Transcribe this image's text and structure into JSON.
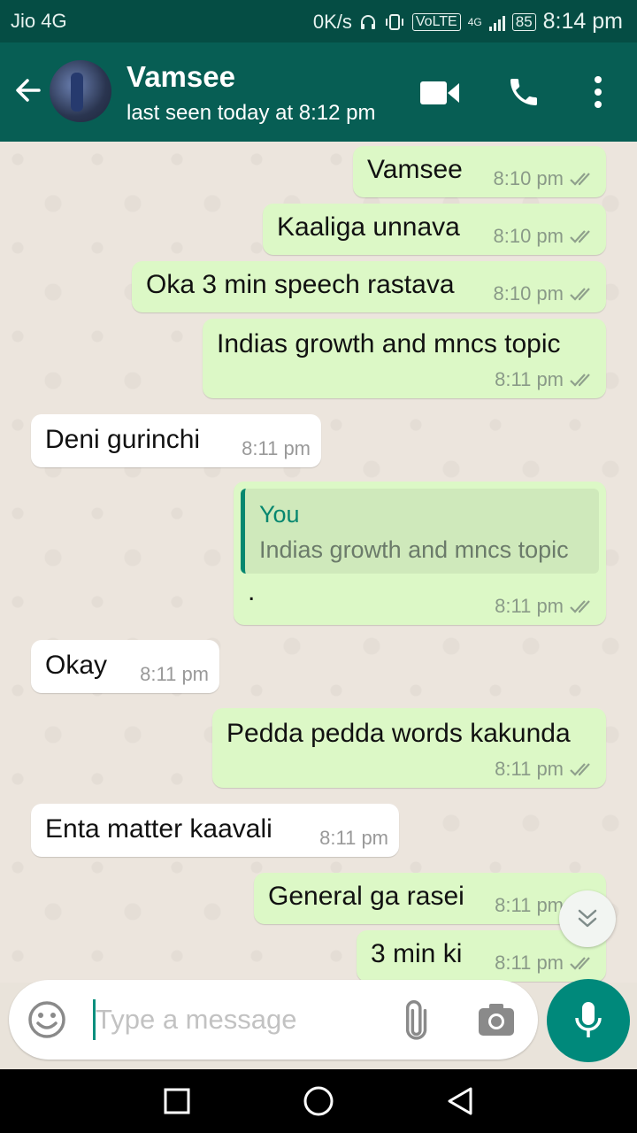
{
  "status": {
    "carrier": "Jio 4G",
    "speed": "0K/s",
    "volte": "VoLTE",
    "network": "4G",
    "battery": "85",
    "time": "8:14 pm"
  },
  "header": {
    "name": "Vamsee",
    "subtitle": "last seen today at 8:12 pm"
  },
  "messages": [
    {
      "dir": "out",
      "text": "Vamsee",
      "time": "8:10 pm"
    },
    {
      "dir": "out",
      "text": "Kaaliga unnava",
      "time": "8:10 pm"
    },
    {
      "dir": "out",
      "text": "Oka 3 min speech rastava",
      "time": "8:10 pm"
    },
    {
      "dir": "out",
      "text": "Indias growth and mncs topic",
      "time": "8:11 pm"
    },
    {
      "dir": "in",
      "text": "Deni gurinchi",
      "time": "8:11 pm"
    },
    {
      "dir": "out",
      "text": ".",
      "time": "8:11 pm",
      "quote_name": "You",
      "quote_text": "Indias growth and mncs topic"
    },
    {
      "dir": "in",
      "text": "Okay",
      "time": "8:11 pm"
    },
    {
      "dir": "out",
      "text": "Pedda pedda words kakunda",
      "time": "8:11 pm"
    },
    {
      "dir": "in",
      "text": "Enta matter kaavali",
      "time": "8:11 pm"
    },
    {
      "dir": "out",
      "text": "General ga rasei",
      "time": "8:11 pm"
    },
    {
      "dir": "out",
      "text": "3 min ki",
      "time": "8:11 pm"
    }
  ],
  "composer": {
    "placeholder": "Type a message"
  },
  "icons": {
    "back": "arrow-left-icon",
    "video": "video-camera-icon",
    "call": "phone-icon",
    "menu": "more-vert-icon",
    "emoji": "emoji-icon",
    "attach": "paperclip-icon",
    "camera": "camera-icon",
    "mic": "microphone-icon",
    "scroll": "chevron-double-down-icon",
    "tick": "double-check-icon"
  },
  "colors": {
    "header": "#075e54",
    "statusbar": "#054d44",
    "outgoing": "#dcf8c6",
    "incoming": "#ffffff",
    "accent": "#00897b"
  }
}
